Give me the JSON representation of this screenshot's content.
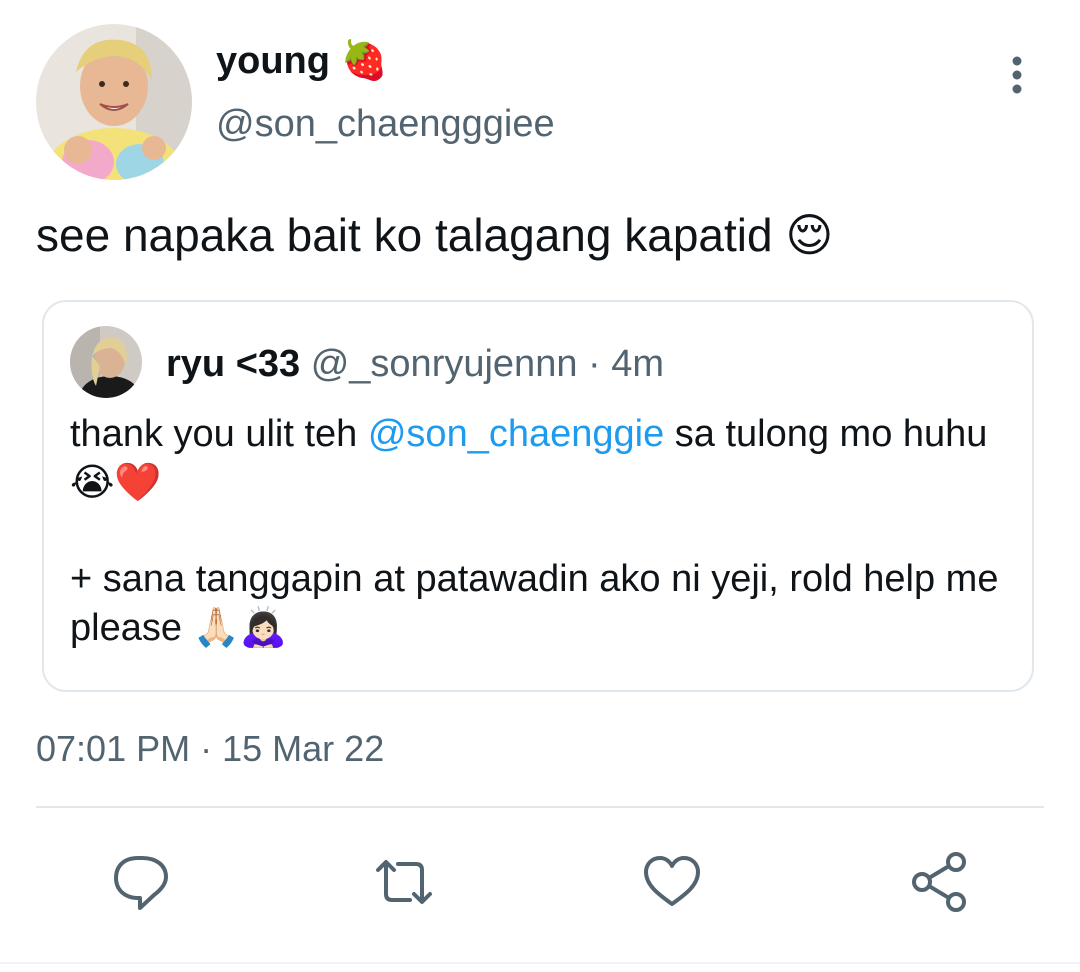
{
  "author": {
    "display_name": "young",
    "name_emoji": "🍓",
    "handle": "@son_chaengggiee"
  },
  "tweet": {
    "text": "see napaka bait ko talagang kapatid",
    "emoji": "😌"
  },
  "quoted_tweet": {
    "display_name": "ryu <33",
    "handle": "@_sonryujennn",
    "separator": "·",
    "time_ago": "4m",
    "line1_prefix": "thank you ulit teh ",
    "mention": "@son_chaenggie",
    "line1_suffix": " sa tulong mo huhu ",
    "line1_emoji": "😭❤️",
    "line2_text": "+ sana tanggapin at patawadin ako ni yeji, rold help me please ",
    "line2_emoji": "🙏🏻🙇🏻‍♀️"
  },
  "meta": {
    "time": "07:01 PM",
    "separator": "·",
    "date": "15 Mar 22"
  },
  "actions": {
    "reply": "reply-icon",
    "retweet": "retweet-icon",
    "like": "heart-icon",
    "share": "share-icon"
  },
  "colors": {
    "text": "#0f1419",
    "secondary": "#536471",
    "mention": "#1d9bf0",
    "border": "#e1e8ed"
  }
}
